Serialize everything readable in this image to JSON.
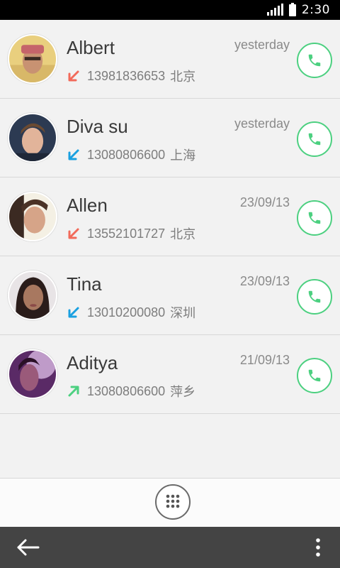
{
  "status_bar": {
    "time": "2:30"
  },
  "calls": [
    {
      "name": "Albert",
      "number": "13981836653",
      "location": "北京",
      "date": "yesterday",
      "direction": "missed-incoming"
    },
    {
      "name": "Diva su",
      "number": "13080806600",
      "location": "上海",
      "date": "yesterday",
      "direction": "incoming"
    },
    {
      "name": "Allen",
      "number": "13552101727",
      "location": "北京",
      "date": "23/09/13",
      "direction": "missed-incoming"
    },
    {
      "name": "Tina",
      "number": "13010200080",
      "location": "深圳",
      "date": "23/09/13",
      "direction": "incoming"
    },
    {
      "name": "Aditya",
      "number": "13080806600",
      "location": "萍乡",
      "date": "21/09/13",
      "direction": "outgoing"
    }
  ],
  "colors": {
    "missed": "#f26a5a",
    "incoming": "#1aa0e0",
    "outgoing": "#4cd080",
    "call_accent": "#4cd080"
  },
  "icons": {
    "call_button": "phone-icon",
    "dialpad": "dialpad-icon",
    "back": "back-arrow-icon",
    "menu": "overflow-menu-icon"
  }
}
